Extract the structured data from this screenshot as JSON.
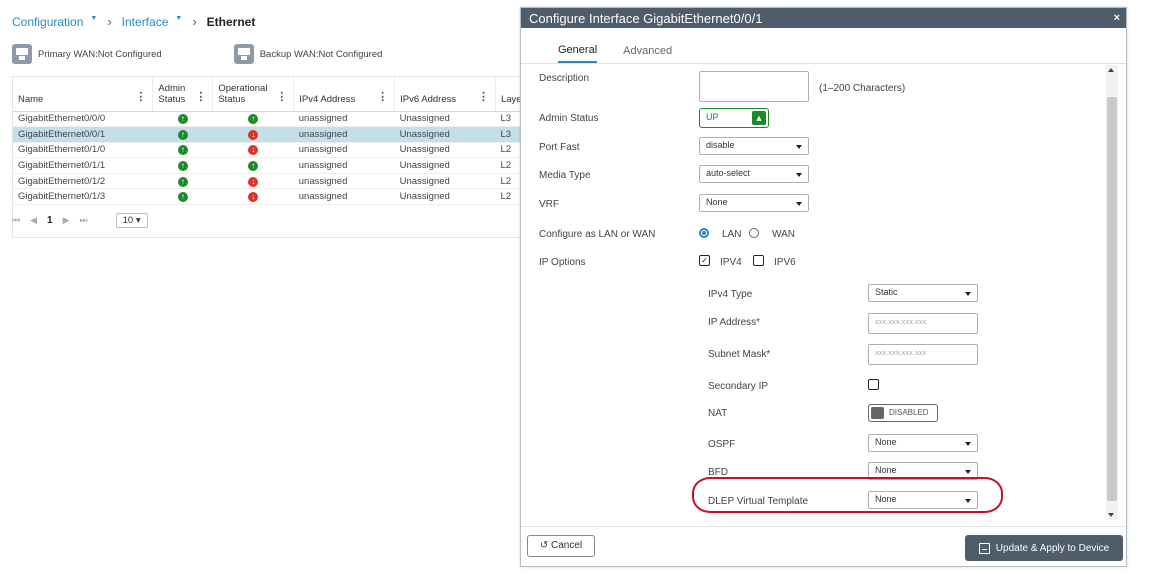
{
  "breadcrumb": {
    "items": [
      "Configuration",
      "Interface",
      "Ethernet"
    ]
  },
  "wan": {
    "primary": "Primary WAN:Not Configured",
    "backup": "Backup WAN:Not Configured"
  },
  "table": {
    "columns": [
      "Name",
      "Admin Status",
      "Operational Status",
      "IPv4 Address",
      "IPv6 Address",
      "Laye"
    ],
    "rows": [
      {
        "name": "GigabitEthernet0/0/0",
        "admin": "up",
        "oper": "up",
        "ipv4": "unassigned",
        "ipv6": "Unassigned",
        "layer": "L3"
      },
      {
        "name": "GigabitEthernet0/0/1",
        "admin": "up",
        "oper": "down",
        "ipv4": "unassigned",
        "ipv6": "Unassigned",
        "layer": "L3"
      },
      {
        "name": "GigabitEthernet0/1/0",
        "admin": "up",
        "oper": "down",
        "ipv4": "unassigned",
        "ipv6": "Unassigned",
        "layer": "L2"
      },
      {
        "name": "GigabitEthernet0/1/1",
        "admin": "up",
        "oper": "up",
        "ipv4": "unassigned",
        "ipv6": "Unassigned",
        "layer": "L2"
      },
      {
        "name": "GigabitEthernet0/1/2",
        "admin": "up",
        "oper": "down",
        "ipv4": "unassigned",
        "ipv6": "Unassigned",
        "layer": "L2"
      },
      {
        "name": "GigabitEthernet0/1/3",
        "admin": "up",
        "oper": "down",
        "ipv4": "unassigned",
        "ipv6": "Unassigned",
        "layer": "L2"
      }
    ],
    "selected_row": 1
  },
  "pager": {
    "first": "⏮",
    "prev": "◀",
    "page": "1",
    "next": "▶",
    "last": "⏭",
    "page_size": "10"
  },
  "modal": {
    "title": "Configure Interface GigabitEthernet0/0/1",
    "close": "×",
    "tabs": [
      "General",
      "Advanced"
    ],
    "description_label": "Description",
    "description_value": "",
    "description_hint": "(1–200 Characters)",
    "admin_status_label": "Admin Status",
    "admin_status_value": "UP",
    "port_fast_label": "Port Fast",
    "port_fast_value": "disable",
    "media_type_label": "Media Type",
    "media_type_value": "auto-select",
    "vrf_label": "VRF",
    "vrf_value": "None",
    "lan_wan_label": "Configure as LAN or WAN",
    "lan_label": "LAN",
    "wan_label": "WAN",
    "lan_wan_selected": "LAN",
    "ip_options_label": "IP Options",
    "ipv4_label": "IPV4",
    "ipv6_label": "IPV6",
    "ipv4_checked": true,
    "ipv6_checked": false,
    "ipv4_type_label": "IPv4 Type",
    "ipv4_type_value": "Static",
    "ip_address_label": "IP Address*",
    "ip_address_placeholder": "xxx.xxx.xxx.xxx",
    "subnet_label": "Subnet Mask*",
    "subnet_placeholder": "xxx.xxx.xxx.xxx",
    "secondary_ip_label": "Secondary IP",
    "nat_label": "NAT",
    "nat_value": "DISABLED",
    "ospf_label": "OSPF",
    "ospf_value": "None",
    "bfd_label": "BFD",
    "bfd_value": "None",
    "dlep_label": "DLEP Virtual Template",
    "dlep_value": "None",
    "cancel_label": "Cancel",
    "apply_label": "Update & Apply to Device"
  },
  "colors": {
    "accent": "#2a8ac7",
    "header": "#4f5c6a",
    "up": "#1a8a2b",
    "down": "#d9342b",
    "highlight": "#c8102e"
  }
}
